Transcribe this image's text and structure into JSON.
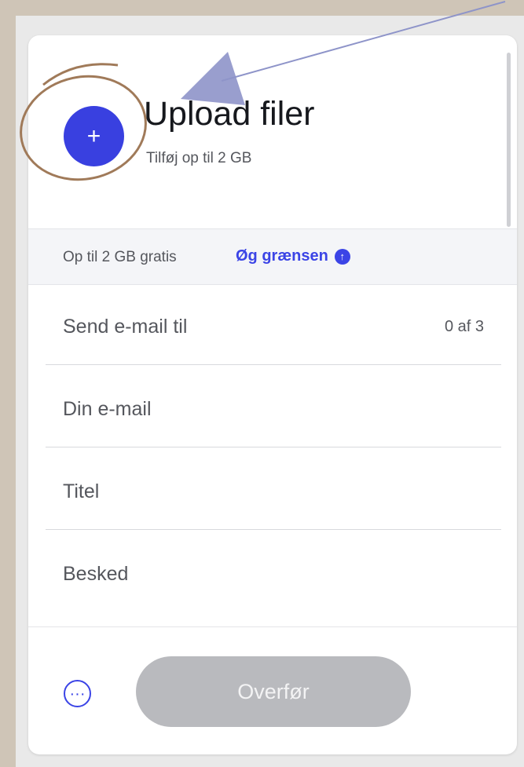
{
  "colors": {
    "accent": "#3b44e6",
    "upload_button": "#3940e0",
    "disabled_button": "#b9babe",
    "background": "#cfc5b7",
    "annotation_arrow": "#8e94c9",
    "annotation_circle": "#a07a59"
  },
  "upload": {
    "button_icon": "plus-icon",
    "button_symbol": "+",
    "title": "Upload filer",
    "subtitle": "Tilføj op til 2 GB"
  },
  "limit": {
    "text": "Op til 2 GB gratis",
    "link_label": "Øg grænsen",
    "link_icon": "arrow-up-circle-icon",
    "link_symbol": "↑"
  },
  "form": {
    "recipients_placeholder": "Send e-mail til",
    "recipients_count": "0 af 3",
    "sender_placeholder": "Din e-mail",
    "title_placeholder": "Titel",
    "message_placeholder": "Besked"
  },
  "actions": {
    "more_icon": "more-options-icon",
    "more_symbol": "···",
    "transfer_label": "Overfør"
  }
}
